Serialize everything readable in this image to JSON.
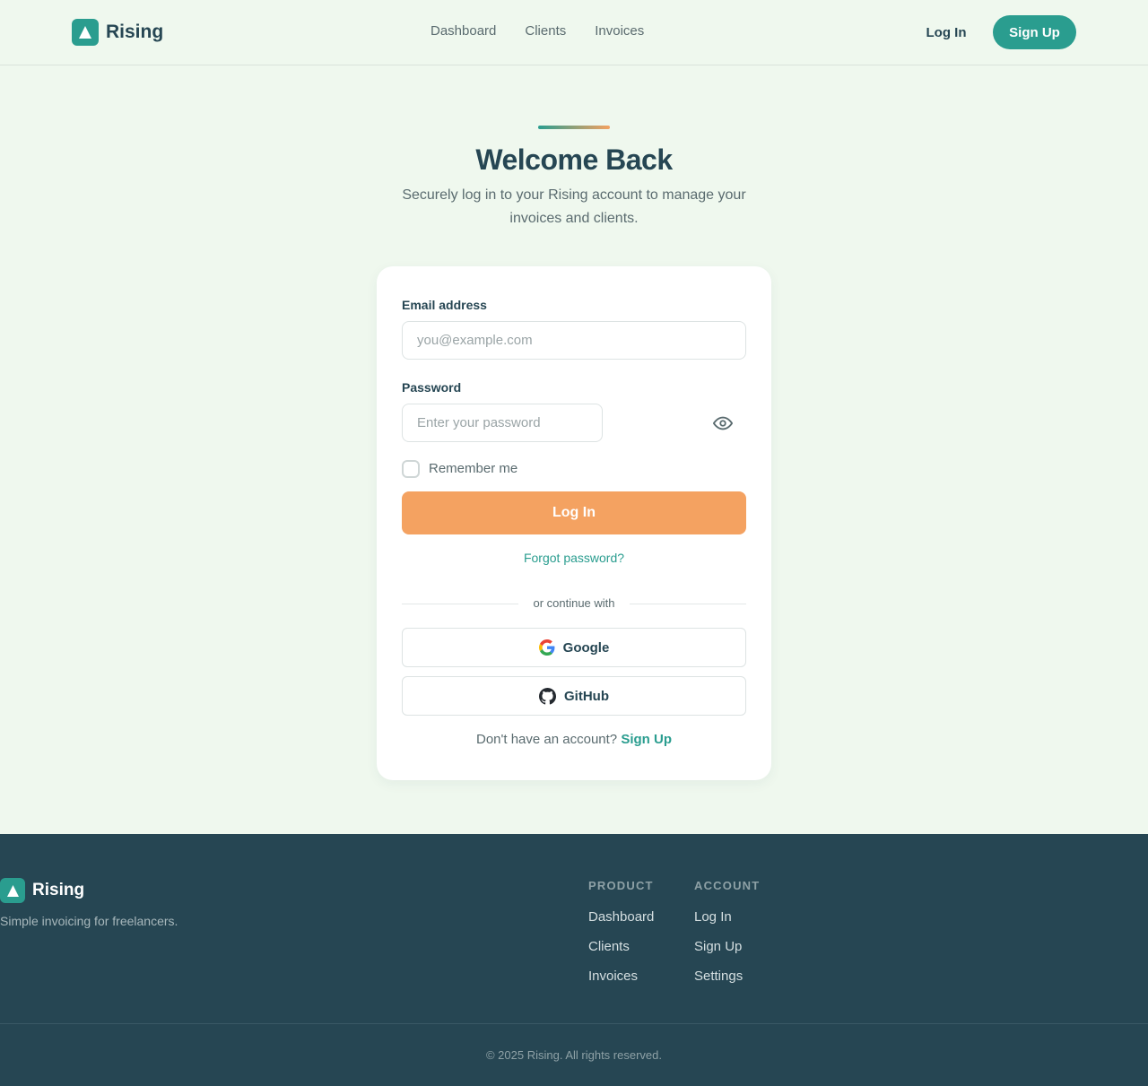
{
  "header": {
    "brand": "Rising",
    "nav": [
      "Dashboard",
      "Clients",
      "Invoices"
    ],
    "login_label": "Log In",
    "signup_label": "Sign Up"
  },
  "hero": {
    "title": "Welcome Back",
    "subtitle": "Securely log in to your Rising account to manage your invoices and clients."
  },
  "form": {
    "email_label": "Email address",
    "email_placeholder": "you@example.com",
    "email_value": "",
    "password_label": "Password",
    "password_placeholder": "Enter your password",
    "password_value": "",
    "remember_label": "Remember me",
    "remember_checked": false,
    "submit_label": "Log In",
    "forgot_label": "Forgot password?",
    "divider_text": "or continue with",
    "google_label": "Google",
    "github_label": "GitHub",
    "signup_prompt": "Don't have an account?",
    "signup_link": "Sign Up"
  },
  "footer": {
    "brand": "Rising",
    "tagline": "Simple invoicing for freelancers.",
    "columns": [
      {
        "title": "PRODUCT",
        "items": [
          "Dashboard",
          "Clients",
          "Invoices"
        ]
      },
      {
        "title": "ACCOUNT",
        "items": [
          "Log In",
          "Sign Up",
          "Settings"
        ]
      }
    ],
    "copyright": "© 2025 Rising. All rights reserved."
  },
  "colors": {
    "primary": "#2a9d8f",
    "accent": "#f4a261",
    "dark": "#264653",
    "background": "#eff8ee"
  },
  "icons": [
    "logo-triangle-icon",
    "eye-icon",
    "google-icon",
    "github-icon"
  ]
}
